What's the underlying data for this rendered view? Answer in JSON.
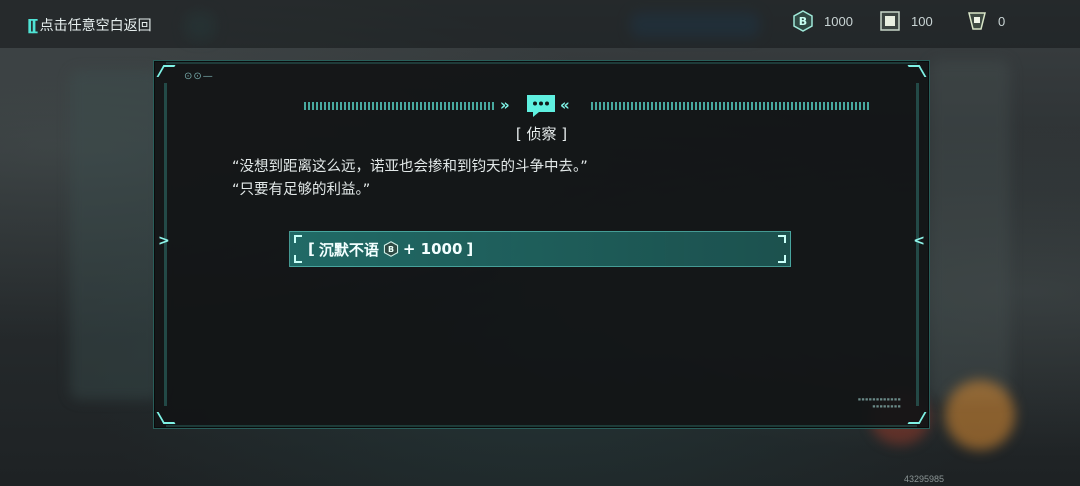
{
  "top_bar": {
    "back_label": "点击任意空白返回",
    "resources": [
      {
        "icon": "coin-icon",
        "value": "1000"
      },
      {
        "icon": "chip-icon",
        "value": "100"
      },
      {
        "icon": "ticket-icon",
        "value": "0"
      }
    ]
  },
  "dialog": {
    "title": "[ 侦察 ]",
    "lines": [
      "“没想到距离这么远，诺亚也会掺和到钧天的斗争中去。”",
      "“只要有足够的利益。”"
    ],
    "choice": {
      "open": "[",
      "label": "沉默不语",
      "reward": "+ 1000",
      "close": "]",
      "reward_icon": "coin-icon"
    }
  },
  "footer": {
    "id": "43295985"
  },
  "colors": {
    "accent": "#4fe3d5",
    "choice_bg": "#24786f"
  }
}
